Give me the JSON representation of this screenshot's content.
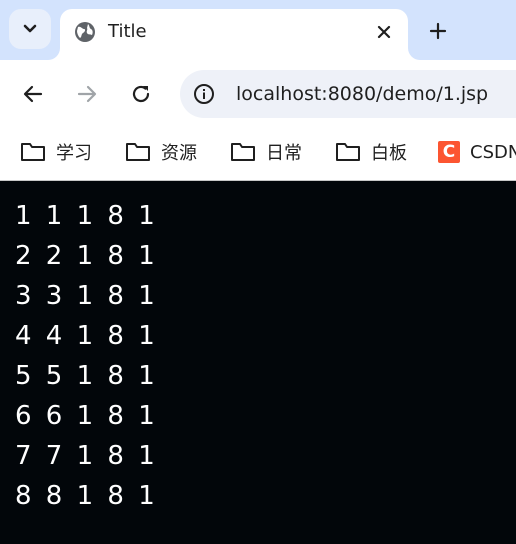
{
  "tab": {
    "title": "Title"
  },
  "toolbar": {
    "url": "localhost:8080/demo/1.jsp"
  },
  "bookmarks": [
    {
      "label": "学习",
      "icon": "folder-icon"
    },
    {
      "label": "资源",
      "icon": "folder-icon"
    },
    {
      "label": "日常",
      "icon": "folder-icon"
    },
    {
      "label": "白板",
      "icon": "folder-icon"
    },
    {
      "label": "CSDN",
      "icon": "csdn-icon",
      "icon_letter": "C"
    }
  ],
  "page": {
    "lines": [
      "1 1 1 8 1",
      "2 2 1 8 1",
      "3 3 1 8 1",
      "4 4 1 8 1",
      "5 5 1 8 1",
      "6 6 1 8 1",
      "7 7 1 8 1",
      "8 8 1 8 1"
    ]
  },
  "colors": {
    "tabstrip": "#d3e3fd",
    "page_background": "#02060a",
    "page_text": "#ffffff",
    "csdn_brand": "#fc5531"
  }
}
